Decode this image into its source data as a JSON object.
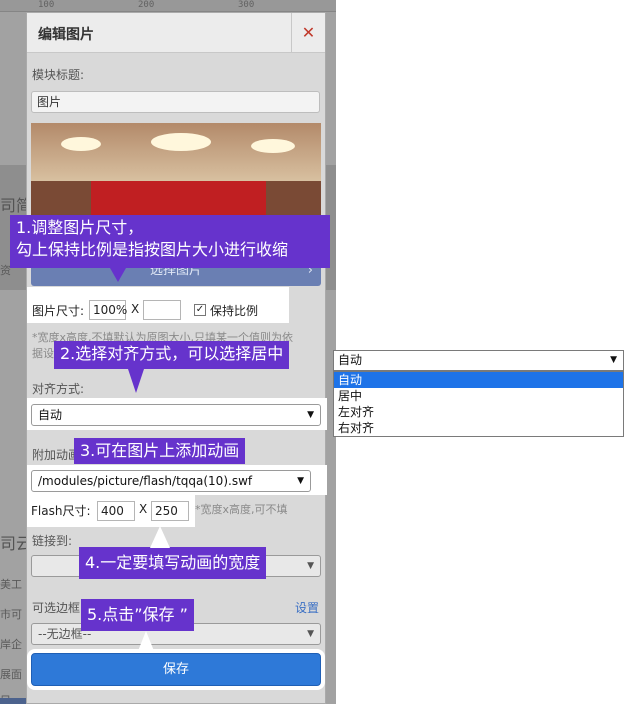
{
  "ruler": {
    "m100": "100",
    "m200": "200",
    "m300": "300"
  },
  "background": {
    "frag_a": "司简",
    "frag_b": "资",
    "frag_c": "司云",
    "frag_d": "美工",
    "frag_e": "市可",
    "frag_f": "岸企",
    "frag_g": "展面",
    "frag_h": "目"
  },
  "dialog": {
    "title": "编辑图片",
    "close_icon": "close-icon",
    "module_title_label": "模块标题:",
    "module_title_value": "图片",
    "choose_image_label": "选择图片",
    "image_size_label": "图片尺寸:",
    "image_width": "100%",
    "size_separator": "X",
    "image_height": "",
    "keep_ratio_label": "保持比例",
    "keep_ratio_checked": true,
    "size_hint": "*宽度x高度,不填默认为原图大小,只填某一个值则为依",
    "size_hint_2": "据设",
    "align_label": "对齐方式:",
    "align_value": "自动",
    "anim_label": "附加动画",
    "anim_value": "/modules/picture/flash/tqqa(10).swf",
    "flash_size_label": "Flash尺寸:",
    "flash_width": "400",
    "flash_separator": "X",
    "flash_height": "250",
    "flash_hint": "*宽度x高度,可不填",
    "link_label": "链接到:",
    "border_label": "可选边框",
    "border_setting_link": "设置",
    "border_value": "--无边框--",
    "save_label": "保存"
  },
  "tips": {
    "tip1_line1": "1.调整图片尺寸，",
    "tip1_line2": "勾上保持比例是指按图片大小进行收缩",
    "tip2": "2.选择对齐方式，可以选择居中",
    "tip3": "3.可在图片上添加动画",
    "tip4": "4.一定要填写动画的宽度",
    "tip5": "5.点击”保存 ”"
  },
  "align_dropdown": {
    "selected": "自动",
    "options": [
      "自动",
      "居中",
      "左对齐",
      "右对齐"
    ]
  },
  "colors": {
    "tip_bg": "#6633cc",
    "save_button": "#2e79d8",
    "dropdown_highlight": "#1e73e8",
    "close_icon": "#c0392b"
  }
}
